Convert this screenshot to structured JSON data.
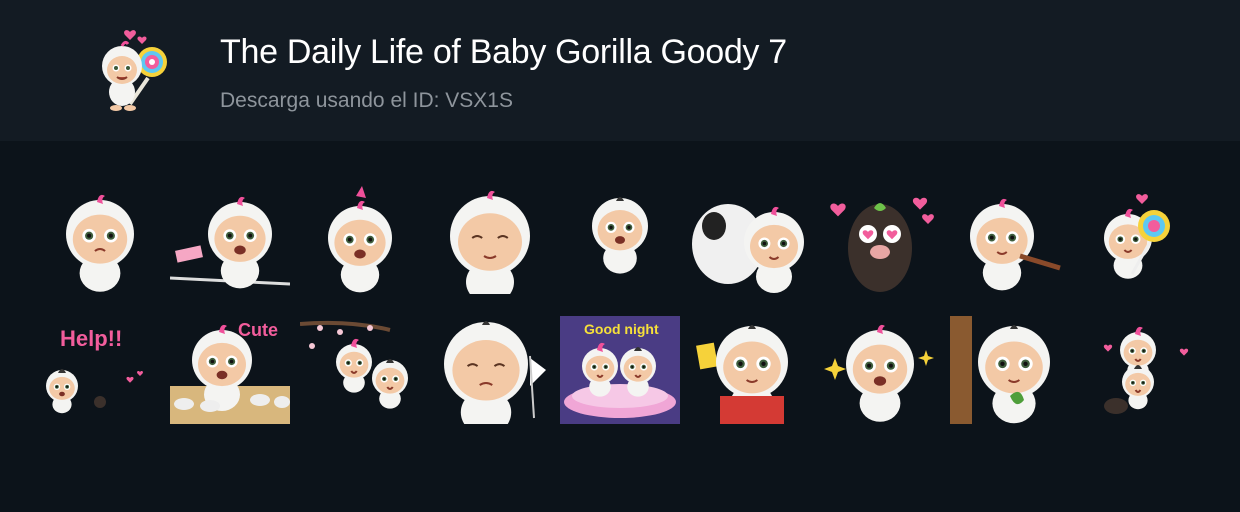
{
  "pack": {
    "title": "The Daily Life of Baby Gorilla Goody 7",
    "subtitle": "Descarga usando el ID: VSX1S"
  },
  "stickers": [
    {
      "name": "sticker-worried",
      "pose": "worried"
    },
    {
      "name": "sticker-crying-rope",
      "pose": "crying"
    },
    {
      "name": "sticker-scared",
      "pose": "scared"
    },
    {
      "name": "sticker-praying",
      "pose": "praying"
    },
    {
      "name": "sticker-jumping",
      "pose": "jumping"
    },
    {
      "name": "sticker-hugging-panda",
      "pose": "hugging"
    },
    {
      "name": "sticker-mole-hearts",
      "pose": "mole"
    },
    {
      "name": "sticker-sausage",
      "pose": "eating"
    },
    {
      "name": "sticker-lollipop",
      "pose": "lollipop"
    },
    {
      "name": "sticker-help",
      "pose": "help",
      "text": "Help!!"
    },
    {
      "name": "sticker-cute-cupcakes",
      "pose": "cute",
      "text": "Cute"
    },
    {
      "name": "sticker-cherry-blossom",
      "pose": "blossom"
    },
    {
      "name": "sticker-white-flag",
      "pose": "flag"
    },
    {
      "name": "sticker-good-night",
      "pose": "goodnight",
      "text": "Good night"
    },
    {
      "name": "sticker-yellow-card",
      "pose": "referee"
    },
    {
      "name": "sticker-sparkle-eyes",
      "pose": "sparkle"
    },
    {
      "name": "sticker-tree-leaf",
      "pose": "tree"
    },
    {
      "name": "sticker-stacked-babies",
      "pose": "stacked"
    }
  ],
  "colors": {
    "header_bg": "#131b23",
    "page_bg": "#0c131a",
    "skin": "#f3c9a6",
    "fur": "#f4f4f2",
    "hair_pink": "#f0509a",
    "heart_pink": "#f25d9c"
  }
}
